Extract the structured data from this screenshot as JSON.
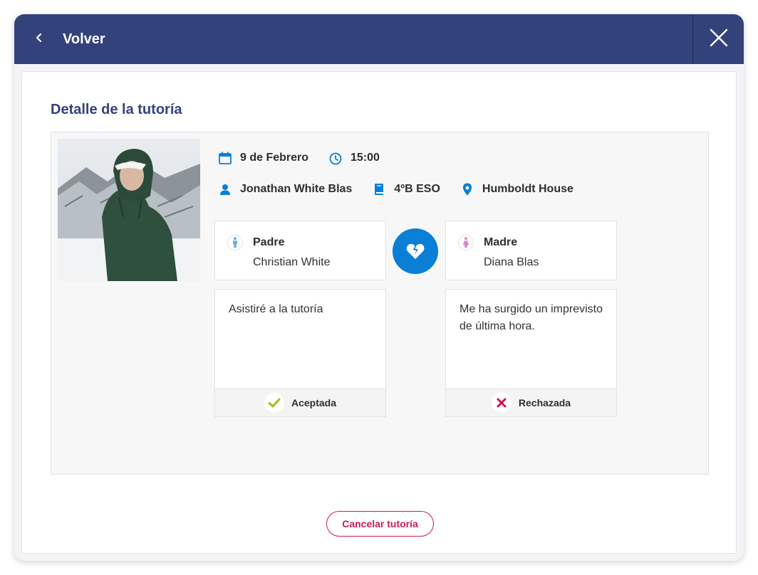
{
  "header": {
    "back_label": "Volver",
    "back_icon": "chevron-left-icon",
    "close_icon": "close-icon",
    "bg_color": "#34427c"
  },
  "page": {
    "title": "Detalle de la tutoría",
    "cancel_button": "Cancelar tutoría"
  },
  "details": {
    "date": "9 de Febrero",
    "time": "15:00",
    "student": "Jonathan White Blas",
    "course": "4ºB ESO",
    "location": "Humboldt House",
    "icons": [
      "calendar-icon",
      "clock-icon",
      "user-icon",
      "book-icon",
      "location-pin-icon"
    ],
    "accent_color": "#0a7fd6"
  },
  "parents": [
    {
      "role": "Padre",
      "name": "Christian White",
      "icon": "male-icon",
      "icon_color": "#6aaee0",
      "message": "Asistiré a la tutoría",
      "status": "Aceptada",
      "status_icon": "check-icon",
      "status_color": "#9cc31b"
    },
    {
      "role": "Madre",
      "name": "Diana Blas",
      "icon": "female-icon",
      "icon_color": "#d48ac9",
      "message": "Me ha surgido un imprevisto de última hora.",
      "status": "Rechazada",
      "status_icon": "cross-icon",
      "status_color": "#d2134e"
    }
  ],
  "relationship_icon": "broken-heart-icon"
}
